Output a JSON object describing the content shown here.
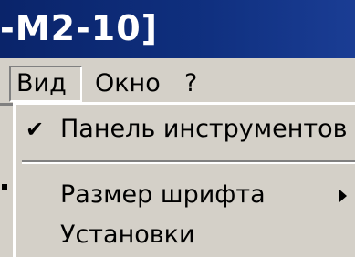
{
  "window": {
    "title_fragment": "-M2-10]"
  },
  "menubar": {
    "items": [
      {
        "label": "Вид",
        "active": true
      },
      {
        "label": "Окно",
        "active": false
      },
      {
        "label": "?",
        "active": false
      }
    ]
  },
  "dropdown": {
    "items": [
      {
        "label": "Панель инструментов",
        "checked": true,
        "check_icon": "check-icon"
      },
      {
        "label": "Размер шрифта",
        "has_submenu": true,
        "submenu_icon": "submenu-arrow-icon"
      },
      {
        "label": "Установки"
      }
    ]
  },
  "colors": {
    "titlebar": "#0a246a",
    "menu_bg": "#d4d0c8",
    "text": "#000000",
    "title_text": "#ffffff"
  }
}
